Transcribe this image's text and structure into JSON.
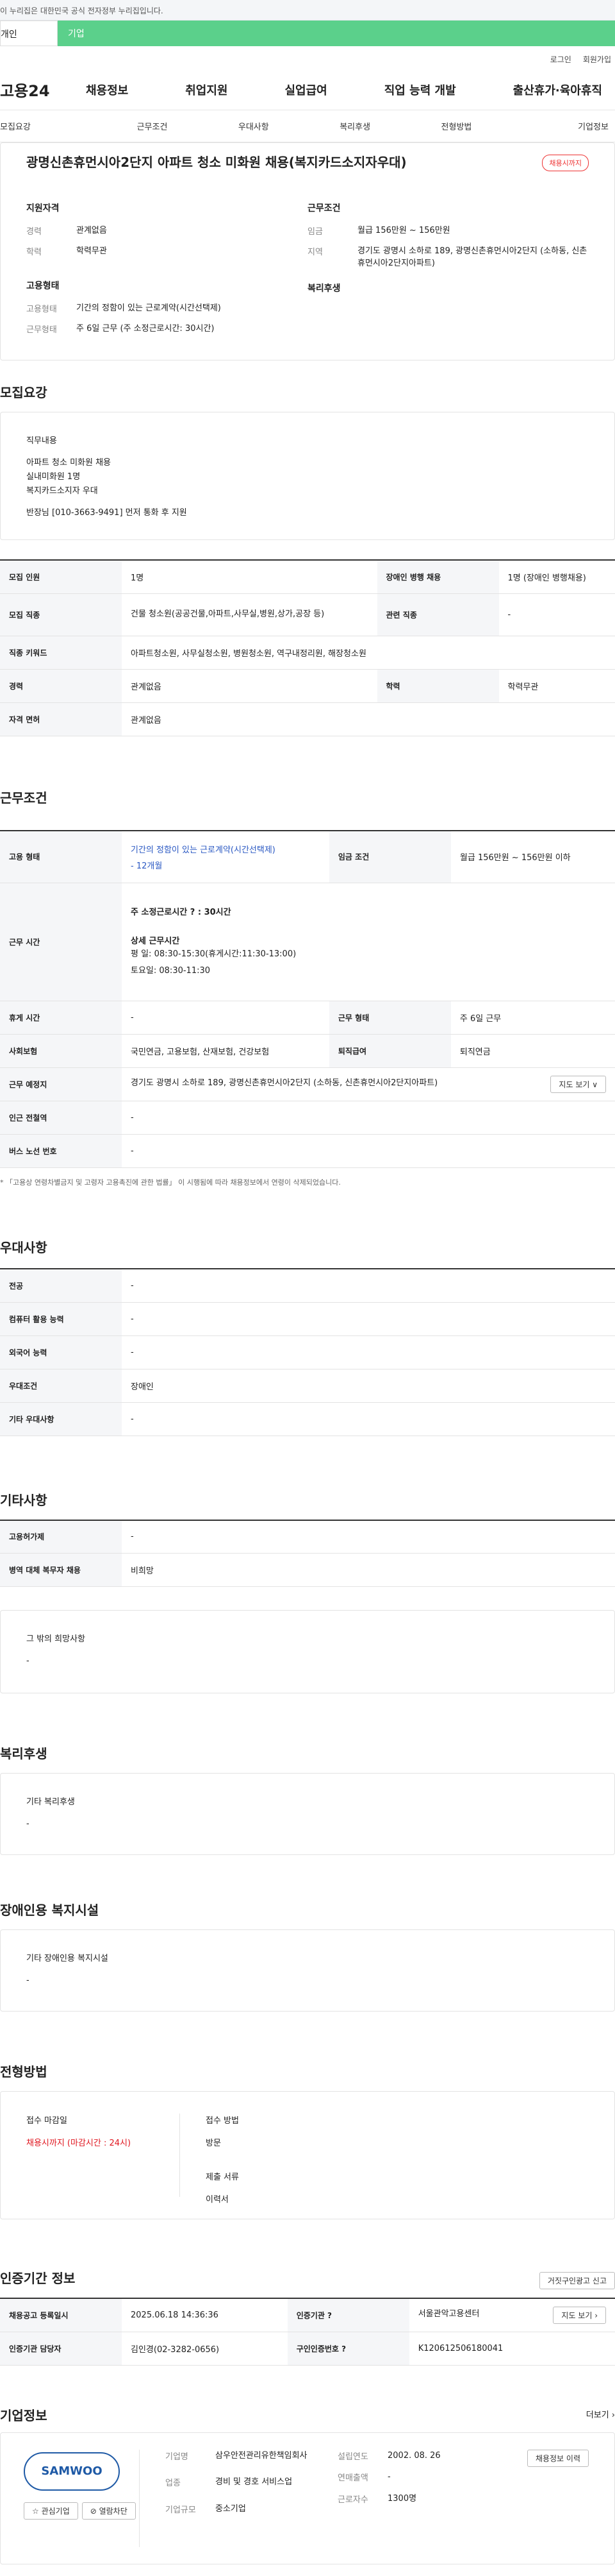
{
  "gov_banner": "이 누리집은 대한민국 공식 전자정부 누리집입니다.",
  "top_tabs": [
    "개인",
    "기업"
  ],
  "util": [
    "로그인",
    "회원가입"
  ],
  "logo": "고용24",
  "gnb": [
    "채용정보",
    "취업지원",
    "실업급여",
    "직업 능력 개발",
    "출산휴가·육아휴직"
  ],
  "subnav": [
    "모집요강",
    "근무조건",
    "우대사항",
    "복리후생",
    "전형방법",
    "기업정보"
  ],
  "summary": {
    "title": "광명신촌휴먼시아2단지 아파트 청소 미화원 채용(복지카드소지자우대)",
    "badge": "채용시까지",
    "qual_h": "지원자격",
    "cond_h": "근무조건",
    "qual": [
      {
        "k": "경력",
        "v": "관계없음"
      },
      {
        "k": "학력",
        "v": "학력무관"
      }
    ],
    "cond": [
      {
        "k": "임금",
        "v": "월급 156만원 ~ 156만원"
      },
      {
        "k": "지역",
        "v": "경기도 광명시 소하로 189, 광명신촌휴먼시아2단지 (소하동, 신촌휴먼시아2단지아파트)"
      }
    ],
    "emp_h": "고용형태",
    "welfare_h": "복리후생",
    "emp": [
      {
        "k": "고용형태",
        "v": "기간의 정함이 있는 근로계약(시간선택제)"
      },
      {
        "k": "근무형태",
        "v": "주 6일 근무 (주 소정근로시간: 30시간)"
      }
    ]
  },
  "recruit": {
    "title": "모집요강",
    "job_h": "직무내용",
    "job_lines": [
      "아파트 청소 미화원 채용",
      "실내미화원 1명",
      "복지카드소지자 우대",
      "",
      "반장님 [010-3663-9491] 먼저 통화 후 지원"
    ],
    "rows": [
      [
        "모집 인원",
        "1명",
        "장애인 병행 채용",
        "1명 (장애인 병행채용)"
      ],
      [
        "모집 직종",
        "건물 청소원(공공건물,아파트,사무실,병원,상가,공장 등)",
        "관련 직종",
        "-"
      ],
      [
        "직종 키워드",
        "아파트청소원, 사무실청소원, 병원청소원, 역구내정리원, 해장청소원"
      ],
      [
        "경력",
        "관계없음",
        "학력",
        "학력무관"
      ],
      [
        "자격 면허",
        "관계없음"
      ]
    ]
  },
  "work": {
    "title": "근무조건",
    "emp_type_h": "고용 형태",
    "emp_type": "기간의 정함이 있는 근로계약(시간선택제)",
    "emp_type_sub": "- 12개월",
    "wage_h": "임금 조건",
    "wage": "월급 156만원 ~ 156만원 이하",
    "time_h": "근무 시간",
    "weekly_hours": "주 소정근로시간 ? : 30시간",
    "detail_h": "상세 근무시간",
    "detail_lines": [
      "평 일: 08:30-15:30(휴게시간:11:30-13:00)",
      "토요일: 08:30-11:30"
    ],
    "break_h": "휴게 시간",
    "break_v": "-",
    "shape_h": "근무 형태",
    "shape_v": "주 6일 근무",
    "ins_h": "사회보험",
    "ins_v": "국민연금, 고용보험, 산재보험, 건강보험",
    "retire_h": "퇴직급여",
    "retire_v": "퇴직연금",
    "place_h": "근무 예정지",
    "place_v": "경기도 광명시 소하로 189, 광명신촌휴먼시아2단지 (소하동, 신촌휴먼시아2단지아파트)",
    "map_btn": "지도 보기 ∨",
    "subway_h": "인근 전철역",
    "subway_v": "-",
    "bus_h": "버스 노선 번호",
    "bus_v": "-",
    "note": "* 「고용상 연령차별금지 및 고령자 고용촉진에 관한 법률」 이 시행됨에 따라 채용정보에서 연령이 삭제되었습니다."
  },
  "pref": {
    "title": "우대사항",
    "rows": [
      [
        "전공",
        "-"
      ],
      [
        "컴퓨터 활용 능력",
        "-"
      ],
      [
        "외국어 능력",
        "-"
      ],
      [
        "우대조건",
        "장애인"
      ],
      [
        "기타 우대사항",
        "-"
      ]
    ]
  },
  "etc": {
    "title": "기타사항",
    "rows": [
      [
        "고용허가제",
        "-"
      ],
      [
        "병역 대체 복무자 채용",
        "비희망"
      ]
    ],
    "other_h": "그 밖의 희망사항",
    "other_v": "-"
  },
  "welfare": {
    "title": "복리후생",
    "h": "기타 복리후생",
    "v": "-"
  },
  "disabled": {
    "title": "장애인용 복지시설",
    "h": "기타 장애인용 복지시설",
    "v": "-"
  },
  "selection": {
    "title": "전형방법",
    "deadline_h": "접수 마감일",
    "deadline_v": "채용시까지 (마감시간 : 24시)",
    "method_h": "접수 방법",
    "method_v": "방문",
    "docs_h": "제출 서류",
    "docs_v": "이력서"
  },
  "cert": {
    "title": "인증기간 정보",
    "report_btn": "거짓구인광고 신고",
    "rows": [
      [
        "채용공고 등록일시",
        "2025.06.18 14:36:36",
        "인증기관 ?",
        "서울관악고용센터"
      ],
      [
        "인증기관 담당자",
        "김인경(02-3282-0656)",
        "구인인증번호 ?",
        "K120612506180041"
      ]
    ],
    "map_btn": "지도 보기 ›"
  },
  "company": {
    "title": "기업정보",
    "more": "더보기 ›",
    "logo_text": "SAMWOO",
    "interest_btn": "☆ 관심기업",
    "block_btn": "⊘ 열람차단",
    "fields": [
      [
        "기업명",
        "삼우안전관리유한책임회사"
      ],
      [
        "업종",
        "경비 및 경호 서비스업"
      ],
      [
        "기업규모",
        "중소기업"
      ]
    ],
    "fields2": [
      [
        "설립연도",
        "2002. 08. 26"
      ],
      [
        "연매출액",
        "-"
      ],
      [
        "근로자수",
        "1300명"
      ]
    ],
    "jobs_btn": "채용정보 이력"
  }
}
